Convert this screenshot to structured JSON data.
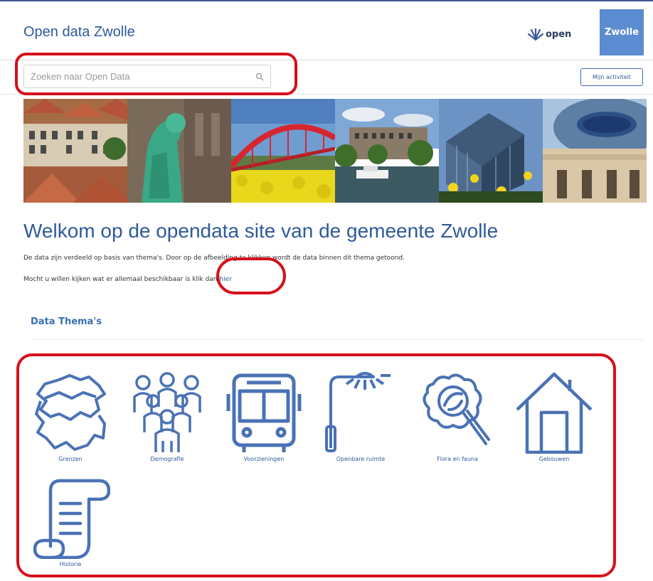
{
  "header": {
    "site_title": "Open data Zwolle",
    "open_logo_text": "open",
    "brand_box_text": "Zwolle",
    "brand_color": "#5b8bd0"
  },
  "search": {
    "placeholder": "Zoeken naar Open Data",
    "value": ""
  },
  "activity_button_label": "Mijn activiteit",
  "banner": {
    "images": [
      "Zwolle old town houses",
      "green glass statue",
      "red arch bridge over yellow flowers",
      "harbour with boats",
      "modern cube buildings",
      "domed museum building"
    ]
  },
  "welcome": {
    "title": "Welkom op de opendata site van de gemeente Zwolle",
    "line1": "De data zijn verdeeld op basis van thema's. Door op de afbeelding te klikken wordt de data binnen dit thema getoond.",
    "line2_prefix": "Mocht u willen kijken wat er allemaal beschikbaar is klik dan ",
    "line2_link": "hier"
  },
  "themes": {
    "title": "Data Thema's",
    "items": [
      {
        "label": "Grenzen",
        "icon": "map-borders-icon"
      },
      {
        "label": "Demografie",
        "icon": "people-group-icon"
      },
      {
        "label": "Voorzieningen",
        "icon": "bus-icon"
      },
      {
        "label": "Openbare ruimte",
        "icon": "street-lamp-icon"
      },
      {
        "label": "Flora en fauna",
        "icon": "magnifier-leaf-icon"
      },
      {
        "label": "Gebouwen",
        "icon": "house-icon"
      },
      {
        "label": "Historie",
        "icon": "scroll-icon"
      }
    ]
  },
  "colors": {
    "accent": "#2f5a9a",
    "icon_blue": "#4a72b5",
    "annotation_red": "#d5101b"
  }
}
